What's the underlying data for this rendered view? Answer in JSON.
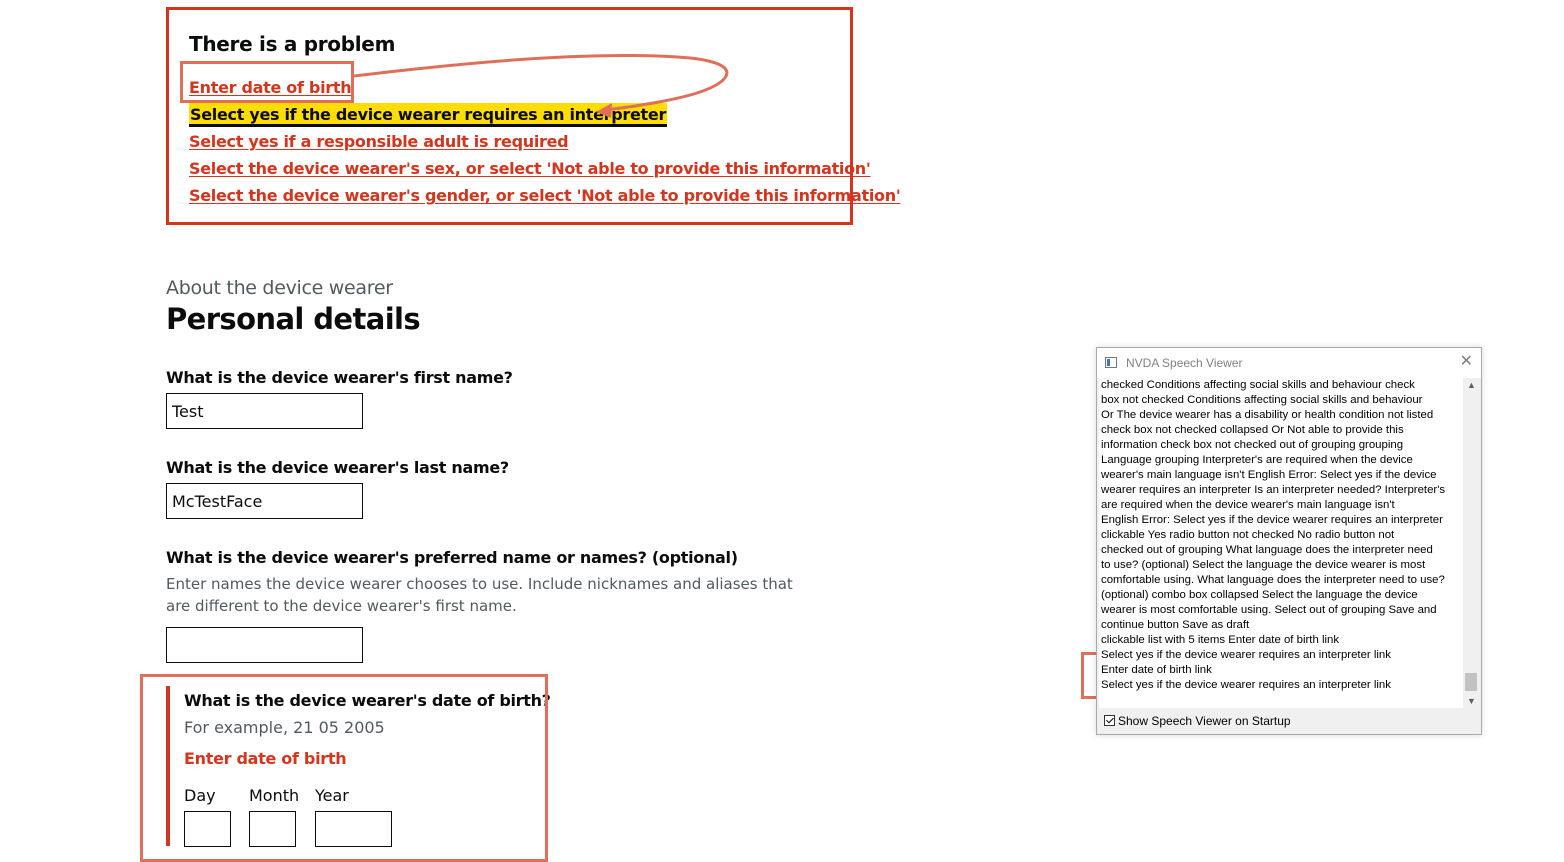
{
  "error_summary": {
    "title": "There is a problem",
    "items": [
      {
        "label": "Enter date of birth"
      },
      {
        "label": "Select yes if the device wearer requires an interpreter"
      },
      {
        "label": "Select yes if a responsible adult is required"
      },
      {
        "label": "Select the device wearer's sex, or select 'Not able to provide this information'"
      },
      {
        "label": "Select the device wearer's gender, or select 'Not able to provide this information'"
      }
    ],
    "focused_index": 1
  },
  "page": {
    "caption": "About the device wearer",
    "title": "Personal details"
  },
  "fields": {
    "first_name": {
      "label": "What is the device wearer's first name?",
      "value": "Test"
    },
    "last_name": {
      "label": "What is the device wearer's last name?",
      "value": "McTestFace"
    },
    "preferred_name": {
      "label": "What is the device wearer's preferred name or names? (optional)",
      "hint": "Enter names the device wearer chooses to use. Include nicknames and aliases that are different to the device wearer's first name.",
      "value": ""
    },
    "dob": {
      "label": "What is the device wearer's date of birth?",
      "hint": "For example, 21 05 2005",
      "error": "Enter date of birth",
      "day_label": "Day",
      "month_label": "Month",
      "year_label": "Year"
    }
  },
  "nvda": {
    "title": "NVDA Speech Viewer",
    "lines": [
      "checked    Conditions affecting social skills and behaviour  check",
      "box  not checked    Conditions affecting social skills and behaviour",
      "Or  The device wearer has a disability or health condition not listed",
      "check box  not checked  collapsed    Or  Not able to provide this",
      "information  check box  not checked    out of grouping  grouping",
      "Language  grouping    Interpreter's are required when the device",
      "wearer's main language isn't English  Error:  Select yes if the device",
      "wearer requires an interpreter  Is an interpreter needed?  Interpreter's",
      "are required when the device wearer's main language isn't",
      "English    Error: Select yes if the device wearer requires an interpreter",
      "clickable  Yes  radio button  not checked    No  radio button  not",
      "checked    out of grouping  What language does the interpreter need",
      "to use? (optional)  Select the language the device wearer is most",
      "comfortable using.  What language does the interpreter need to use?",
      "(optional)  combo box  collapsed    Select the language the device",
      "wearer is most comfortable using.  Select  out of grouping  Save and",
      "continue  button    Save as draft",
      "clickable  list  with 5 items  Enter date of birth  link",
      "Select yes if the device wearer requires an interpreter  link",
      "Enter date of birth  link",
      "Select yes if the device wearer requires an interpreter  link"
    ],
    "startup_label": "Show Speech Viewer on Startup",
    "startup_checked": true
  },
  "colors": {
    "error": "#d4351c",
    "focus": "#ffdd00",
    "annotation": "#e06f5a"
  }
}
